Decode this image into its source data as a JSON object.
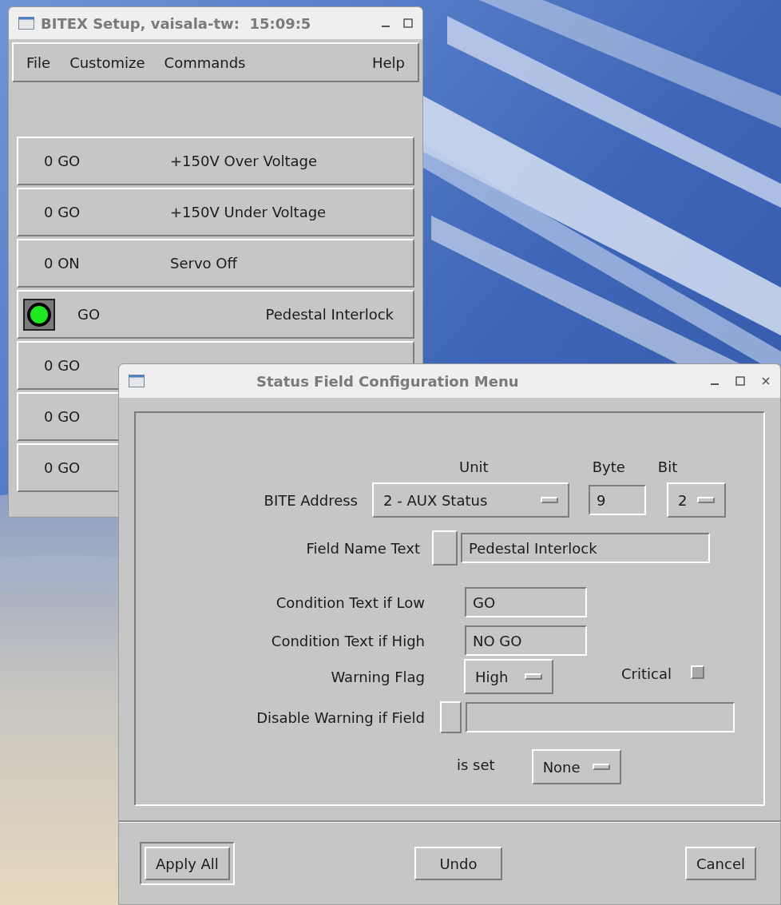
{
  "bitex_window": {
    "title": "BITEX Setup, vaisala-tw:  15:09:5",
    "menu": [
      {
        "label": "File"
      },
      {
        "label": "Customize"
      },
      {
        "label": "Commands"
      },
      {
        "label": "Help"
      }
    ],
    "status_rows": [
      {
        "kind": "text",
        "status": "0 GO",
        "label": "+150V Over Voltage"
      },
      {
        "kind": "text",
        "status": "0 GO",
        "label": "+150V Under Voltage"
      },
      {
        "kind": "text",
        "status": "0 ON",
        "label": "Servo Off"
      },
      {
        "kind": "indicator",
        "color": "#1ee81e",
        "status": "GO",
        "label": "Pedestal Interlock"
      },
      {
        "kind": "text",
        "status": "0 GO"
      },
      {
        "kind": "text",
        "status": "0 GO"
      },
      {
        "kind": "text",
        "status": "0 GO"
      }
    ]
  },
  "dialog": {
    "title": "Status Field Configuration Menu",
    "column_headers": [
      "Unit",
      "Byte",
      "Bit"
    ],
    "bite_address": {
      "label": "BITE Address",
      "unit": "2 - AUX Status",
      "byte": "9",
      "bit": "2"
    },
    "field_name": {
      "label": "Field Name Text",
      "value": "Pedestal Interlock"
    },
    "condition_low": {
      "label": "Condition Text if Low",
      "value": "GO"
    },
    "condition_high": {
      "label": "Condition Text if High",
      "value": "NO GO"
    },
    "warning_flag": {
      "label": "Warning Flag",
      "value": "High"
    },
    "critical": {
      "label": "Critical",
      "checked": false
    },
    "disable_warning": {
      "label": "Disable Warning if Field"
    },
    "is_set": {
      "label": "is set",
      "value": "None"
    },
    "buttons": [
      {
        "label": "Apply All",
        "default": true
      },
      {
        "label": "Undo",
        "default": false
      },
      {
        "label": "Cancel",
        "default": false
      }
    ]
  }
}
